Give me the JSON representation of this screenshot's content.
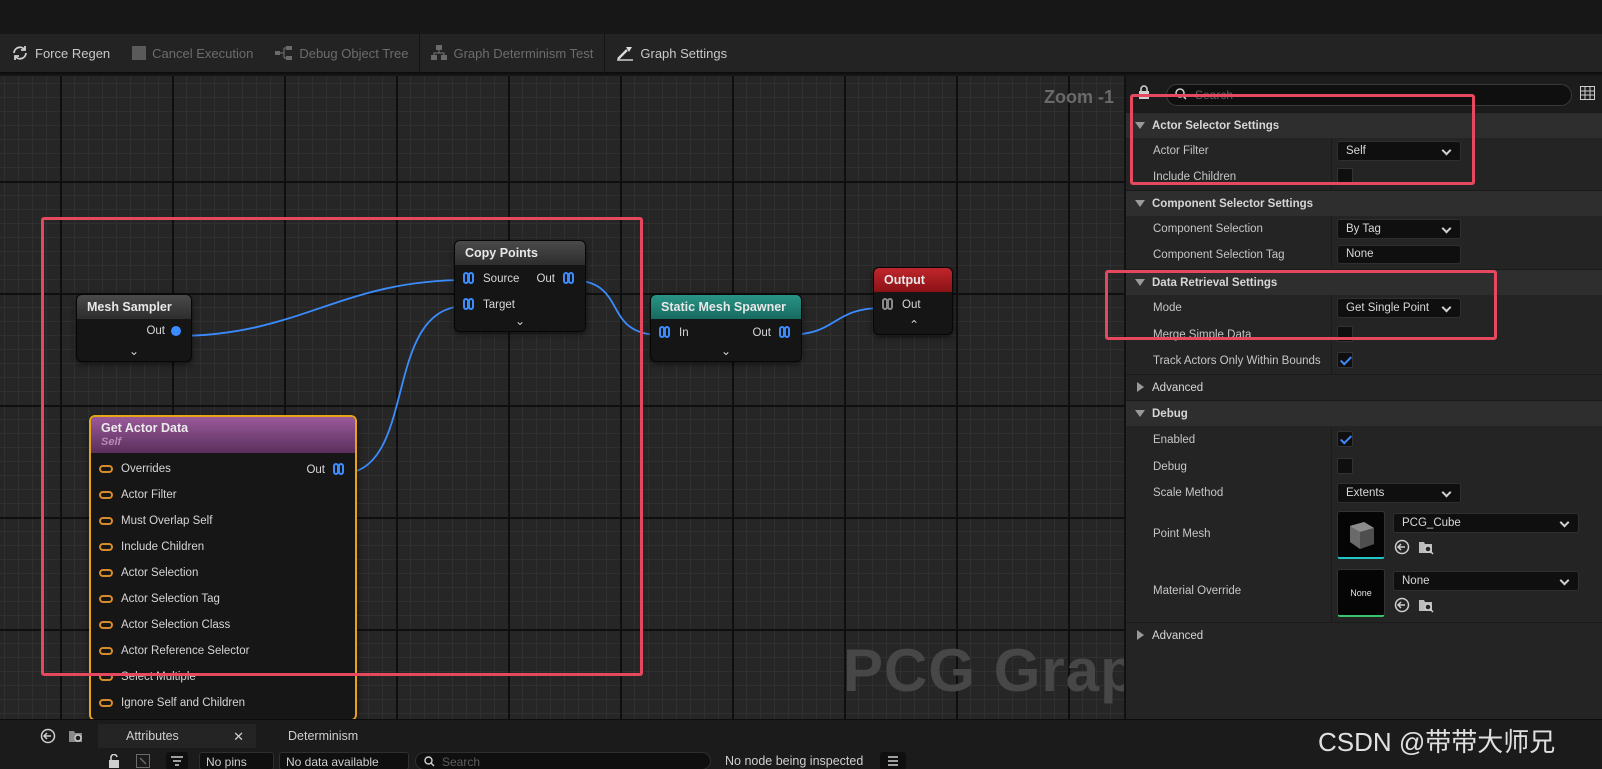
{
  "toolbar": {
    "items": [
      {
        "label": "Force Regen",
        "icon": "refresh-icon",
        "enabled": true
      },
      {
        "label": "Cancel Execution",
        "icon": "stop-icon",
        "enabled": false
      },
      {
        "label": "Debug Object Tree",
        "icon": "tree-icon",
        "enabled": false
      },
      {
        "label": "Graph Determinism Test",
        "icon": "test-icon",
        "enabled": false
      },
      {
        "label": "Graph Settings",
        "icon": "settings-icon",
        "enabled": true
      }
    ]
  },
  "graph": {
    "zoom": "Zoom -1",
    "watermark": "PCG Graph",
    "nodes": {
      "mesh_sampler": {
        "title": "Mesh Sampler",
        "out": "Out"
      },
      "copy_points": {
        "title": "Copy Points",
        "source": "Source",
        "target": "Target",
        "out": "Out"
      },
      "static_mesh_spawner": {
        "title": "Static Mesh Spawner",
        "in": "In",
        "out": "Out"
      },
      "output": {
        "title": "Output",
        "out": "Out"
      },
      "get_actor_data": {
        "title": "Get Actor Data",
        "subtitle": "Self",
        "out": "Out",
        "pins": [
          "Overrides",
          "Actor Filter",
          "Must Overlap Self",
          "Include Children",
          "Actor Selection",
          "Actor Selection Tag",
          "Actor Selection Class",
          "Actor Reference Selector",
          "Select Multiple",
          "Ignore Self and Children"
        ]
      }
    },
    "colors": {
      "mesh_sampler": "#3a3a3a",
      "copy_points": "#3a3a3a",
      "static_mesh_spawner": "#1d7c70",
      "output": "#a3161b",
      "get_actor_data": "#8e4b8e",
      "selected": "#e8a317",
      "wire": "#3b8cff",
      "annotation": "#e5485f"
    }
  },
  "details": {
    "search_placeholder": "Search",
    "sections": {
      "actor_selector": {
        "title": "Actor Selector Settings",
        "actor_filter_label": "Actor Filter",
        "actor_filter_value": "Self",
        "include_children_label": "Include Children",
        "include_children_checked": false
      },
      "component_selector": {
        "title": "Component Selector Settings",
        "component_selection_label": "Component Selection",
        "component_selection_value": "By Tag",
        "component_selection_tag_label": "Component Selection Tag",
        "component_selection_tag_value": "None"
      },
      "data_retrieval": {
        "title": "Data Retrieval Settings",
        "mode_label": "Mode",
        "mode_value": "Get Single Point",
        "merge_simple_data_label": "Merge Simple Data",
        "merge_simple_data_checked": false,
        "track_actors_label": "Track Actors Only Within Bounds",
        "track_actors_checked": true
      },
      "advanced_1": {
        "title": "Advanced"
      },
      "debug": {
        "title": "Debug",
        "enabled_label": "Enabled",
        "enabled_checked": true,
        "debug_label": "Debug",
        "debug_checked": false,
        "scale_method_label": "Scale Method",
        "scale_method_value": "Extents",
        "point_mesh_label": "Point Mesh",
        "point_mesh_value": "PCG_Cube",
        "material_override_label": "Material Override",
        "material_override_value": "None",
        "material_thumb_text": "None"
      },
      "advanced_2": {
        "title": "Advanced"
      }
    }
  },
  "bottom": {
    "tabs": {
      "attributes": "Attributes",
      "determinism": "Determinism"
    },
    "pins_filter": "No pins",
    "data_filter": "No data available",
    "search_placeholder": "Search",
    "status": "No node being inspected"
  },
  "watermark_csdn": "CSDN @带带大师兄"
}
